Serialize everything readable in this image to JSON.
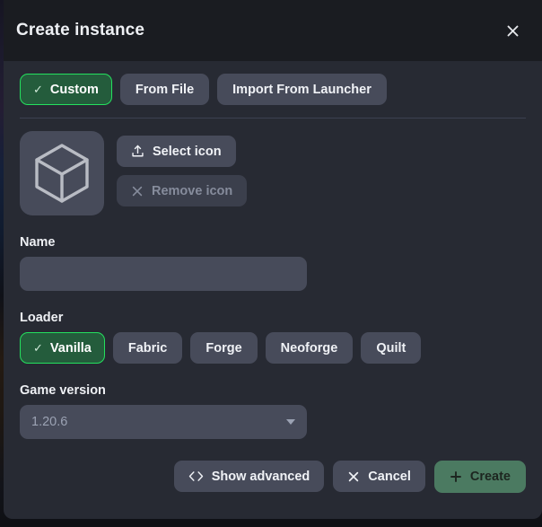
{
  "header": {
    "title": "Create instance",
    "close_icon": "close-icon"
  },
  "tabs": [
    {
      "label": "Custom",
      "selected": true,
      "icon": "check-icon"
    },
    {
      "label": "From File",
      "selected": false
    },
    {
      "label": "Import From Launcher",
      "selected": false
    }
  ],
  "icon_section": {
    "preview_icon": "cube-icon",
    "select_button": {
      "label": "Select icon",
      "icon": "upload-icon",
      "disabled": false
    },
    "remove_button": {
      "label": "Remove icon",
      "icon": "close-icon",
      "disabled": true
    }
  },
  "name_field": {
    "label": "Name",
    "value": "",
    "placeholder": ""
  },
  "loader_field": {
    "label": "Loader",
    "options": [
      {
        "label": "Vanilla",
        "selected": true,
        "icon": "check-icon"
      },
      {
        "label": "Fabric",
        "selected": false
      },
      {
        "label": "Forge",
        "selected": false
      },
      {
        "label": "Neoforge",
        "selected": false
      },
      {
        "label": "Quilt",
        "selected": false
      }
    ]
  },
  "game_version_field": {
    "label": "Game version",
    "value": "1.20.6",
    "caret_icon": "chevron-down-icon"
  },
  "footer": {
    "show_advanced": {
      "label": "Show advanced",
      "icon": "code-brackets-icon"
    },
    "cancel": {
      "label": "Cancel",
      "icon": "close-icon"
    },
    "create": {
      "label": "Create",
      "icon": "plus-icon"
    }
  },
  "colors": {
    "accent_green": "#24e05e",
    "selected_fill": "#245c3c",
    "create_button": "#4b7a61",
    "dialog_bg": "#272a33",
    "titlebar_bg": "#1a1c21",
    "control_bg": "#474b5a"
  }
}
